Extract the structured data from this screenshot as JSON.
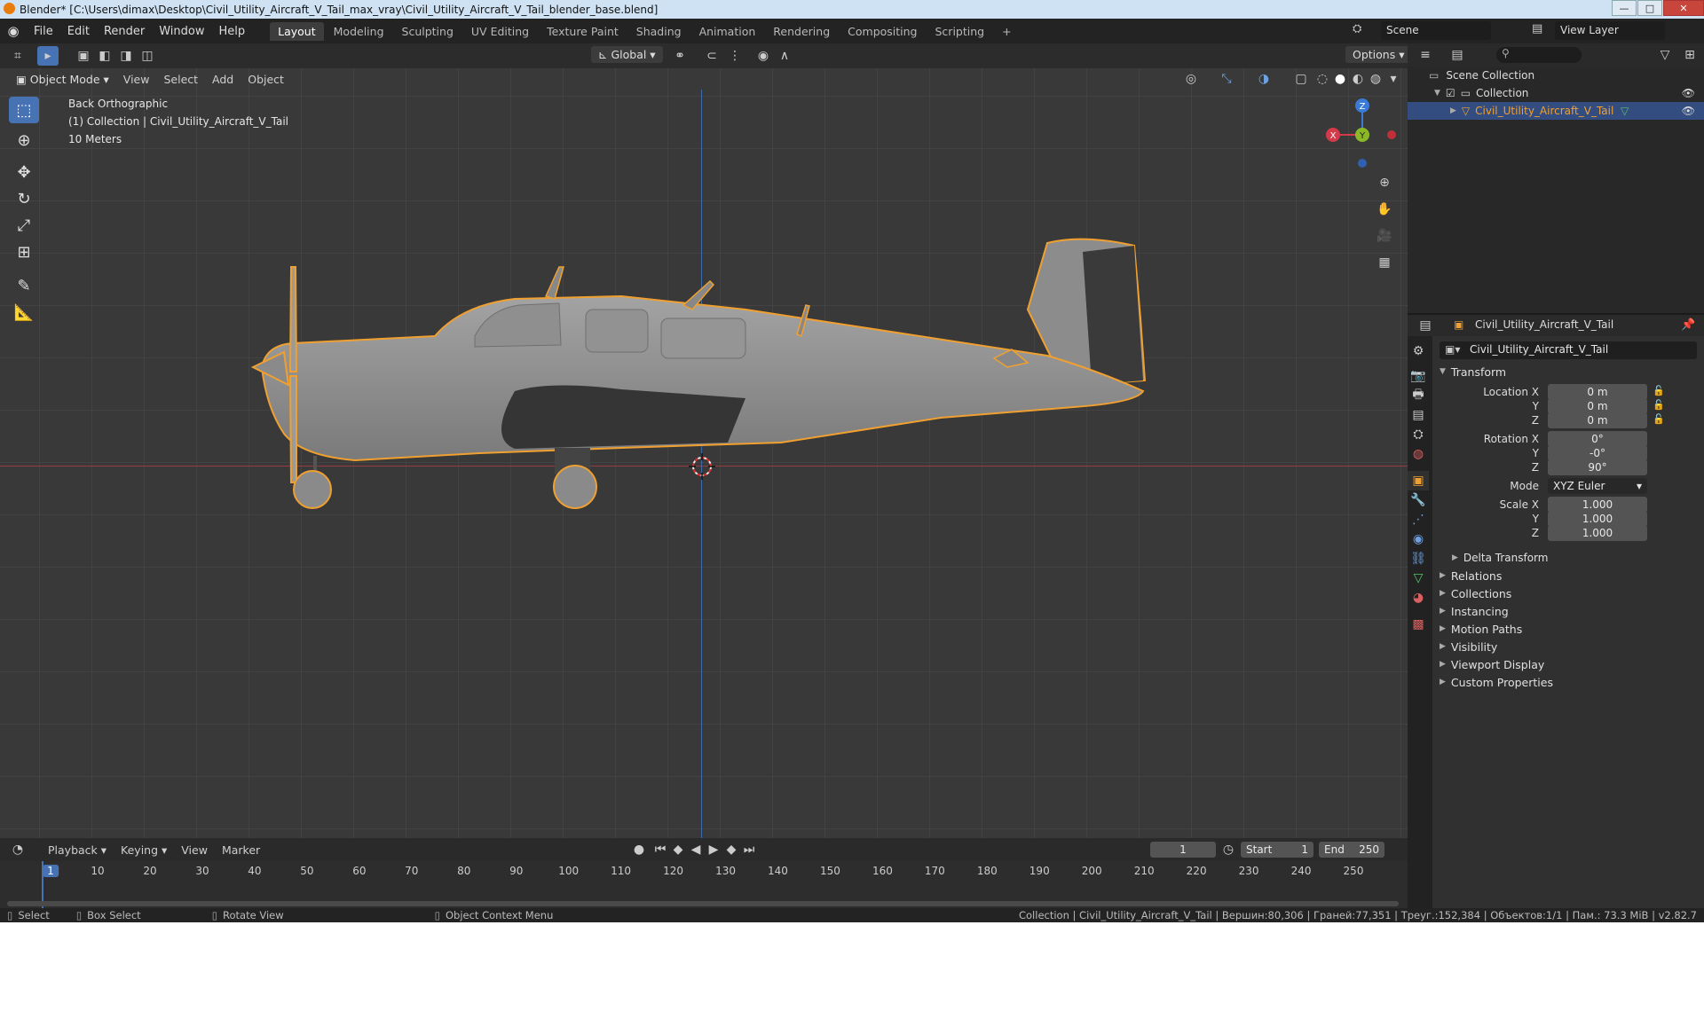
{
  "window": {
    "title": "Blender* [C:\\Users\\dimax\\Desktop\\Civil_Utility_Aircraft_V_Tail_max_vray\\Civil_Utility_Aircraft_V_Tail_blender_base.blend]",
    "minimize": "—",
    "maximize": "□",
    "close": "✕"
  },
  "menu": {
    "items": [
      "File",
      "Edit",
      "Render",
      "Window",
      "Help"
    ],
    "workspaces": [
      "Layout",
      "Modeling",
      "Sculpting",
      "UV Editing",
      "Texture Paint",
      "Shading",
      "Animation",
      "Rendering",
      "Compositing",
      "Scripting"
    ],
    "add_workspace": "+",
    "scene_label": "Scene",
    "view_layer_label": "View Layer"
  },
  "viewport": {
    "orientation": "Global",
    "options_label": "Options",
    "mode": "Object Mode",
    "header_menus": [
      "View",
      "Select",
      "Add",
      "Object"
    ],
    "view_name": "Back Orthographic",
    "collection_info": "(1) Collection | Civil_Utility_Aircraft_V_Tail",
    "scale_info": "10 Meters",
    "gizmo": {
      "z": "Z",
      "y": "Y",
      "x": "X"
    }
  },
  "outliner": {
    "search_placeholder": "",
    "scene_collection": "Scene Collection",
    "collection": "Collection",
    "object": "Civil_Utility_Aircraft_V_Tail"
  },
  "properties": {
    "object_name_header": "Civil_Utility_Aircraft_V_Tail",
    "object_name_field": "Civil_Utility_Aircraft_V_Tail",
    "transform_title": "Transform",
    "location": {
      "label_x": "Location X",
      "label_y": "Y",
      "label_z": "Z",
      "x": "0 m",
      "y": "0 m",
      "z": "0 m"
    },
    "rotation": {
      "label_x": "Rotation X",
      "label_y": "Y",
      "label_z": "Z",
      "x": "0°",
      "y": "-0°",
      "z": "90°"
    },
    "mode_label": "Mode",
    "mode_value": "XYZ Euler",
    "scale": {
      "label_x": "Scale X",
      "label_y": "Y",
      "label_z": "Z",
      "x": "1.000",
      "y": "1.000",
      "z": "1.000"
    },
    "delta_transform": "Delta Transform",
    "panels": [
      "Relations",
      "Collections",
      "Instancing",
      "Motion Paths",
      "Visibility",
      "Viewport Display",
      "Custom Properties"
    ]
  },
  "timeline": {
    "menus": [
      "Playback",
      "Keying",
      "View",
      "Marker"
    ],
    "current_frame": "1",
    "start_label": "Start",
    "start_value": "1",
    "end_label": "End",
    "end_value": "250",
    "ticks": [
      "1",
      "10",
      "20",
      "30",
      "40",
      "50",
      "60",
      "70",
      "80",
      "90",
      "100",
      "110",
      "120",
      "130",
      "140",
      "150",
      "160",
      "170",
      "180",
      "190",
      "200",
      "210",
      "220",
      "230",
      "240",
      "250"
    ]
  },
  "status": {
    "select": "Select",
    "box_select": "Box Select",
    "rotate_view": "Rotate View",
    "context_menu": "Object Context Menu",
    "stats": "Collection | Civil_Utility_Aircraft_V_Tail | Вершин:80,306 | Граней:77,351 | Треуг.:152,384 | Объектов:1/1 | Пам.: 73.3 MiB | v2.82.7"
  },
  "colors": {
    "accent": "#4772b3",
    "selection_outline": "#f0a030",
    "x_axis": "#d33a4a",
    "y_axis": "#8bb829",
    "z_axis": "#3a7bd8"
  }
}
